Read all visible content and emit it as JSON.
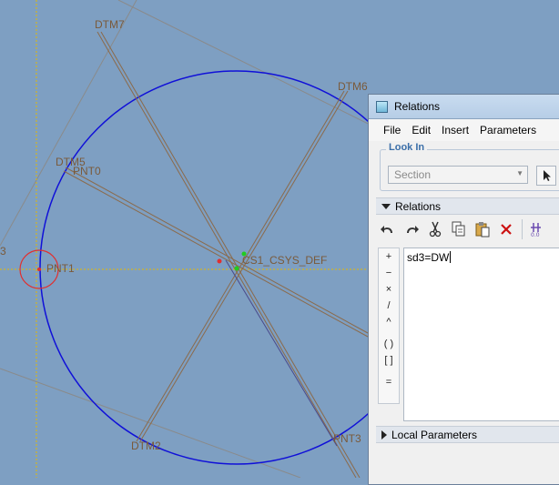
{
  "cad": {
    "labels": {
      "dtm7": "DTM7",
      "dtm6": "DTM6",
      "dtm5": "DTM5",
      "pnt0": "PNT0",
      "pnt1": "PNT1",
      "csys": "CS1_CSYS_DEF",
      "dtm2": "DTM2",
      "pnt3": "PNT3",
      "edge_number": "3"
    },
    "colors": {
      "background": "#7e9fc2",
      "circle": "#1010d8",
      "datum": "#8b6a4a",
      "axis_line": "#e6b800",
      "point_marker": "#e03030",
      "csys_marker": "#22cc22"
    }
  },
  "dialog": {
    "title": "Relations",
    "menu": [
      "File",
      "Edit",
      "Insert",
      "Parameters"
    ],
    "look_in": {
      "label": "Look In",
      "selected": "Section"
    },
    "relations_header": "Relations",
    "toolbar": {
      "undo": "undo-icon",
      "redo": "redo-icon",
      "cut": "scissors-icon",
      "copy": "copy-icon",
      "paste": "paste-icon",
      "delete": "delete-icon",
      "verify": "verify-icon"
    },
    "operators": [
      "+",
      "−",
      "×",
      "/",
      "^",
      "( )",
      "[ ]",
      "="
    ],
    "editor_text": "sd3=DW",
    "local_parameters": "Local Parameters"
  }
}
